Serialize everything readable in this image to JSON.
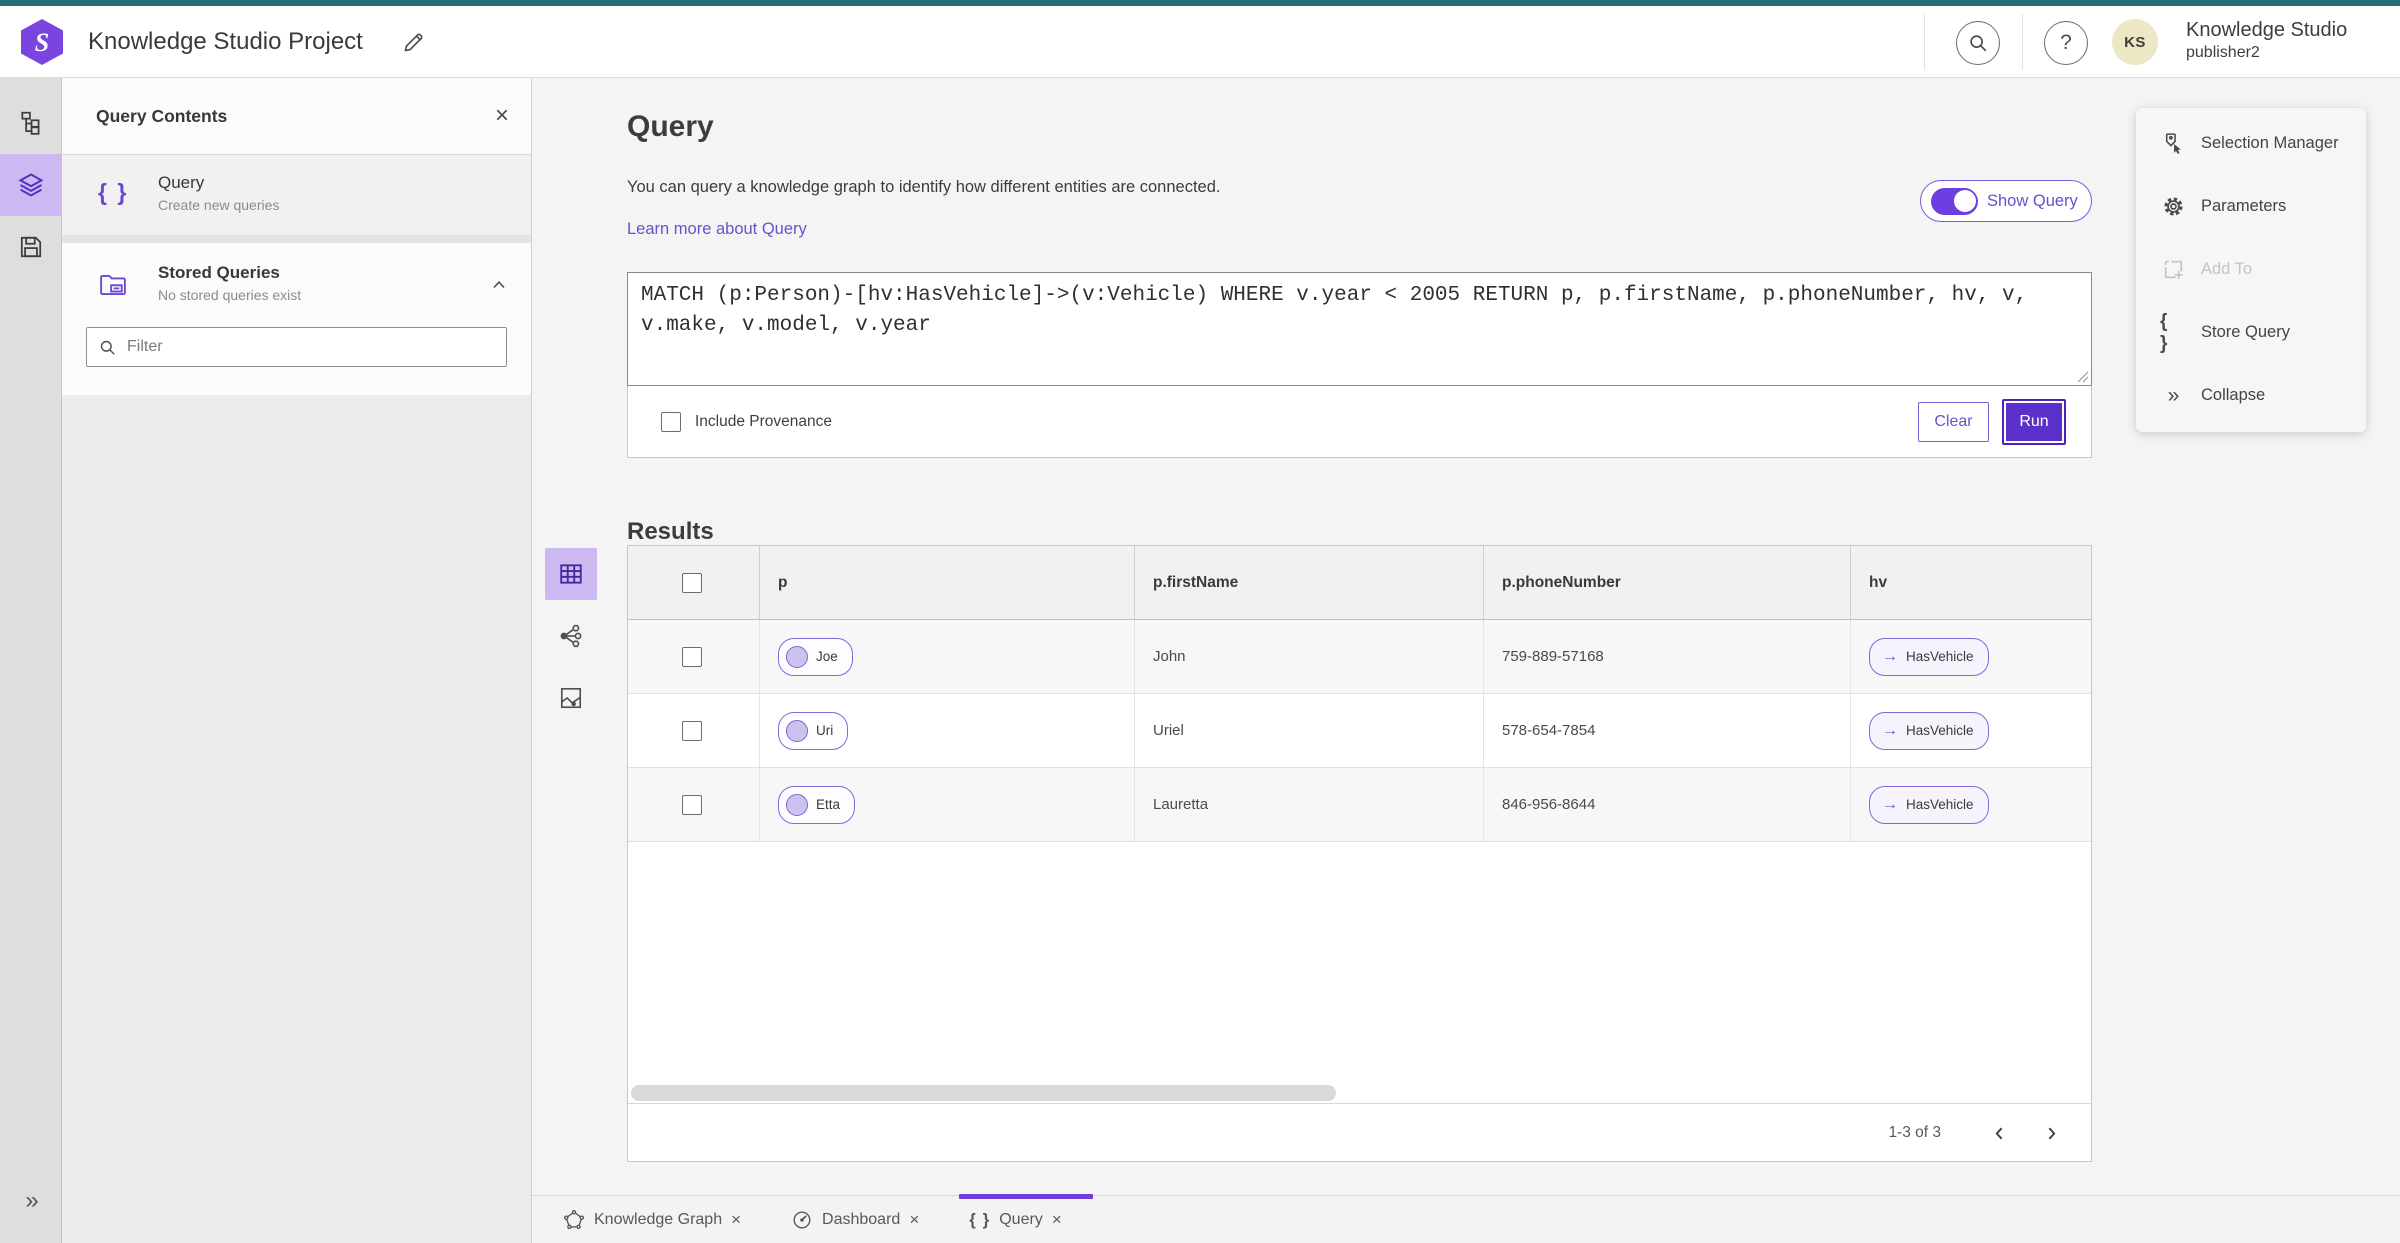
{
  "colors": {
    "accent": "#5b2fc9",
    "accent_light": "#7a5cd8",
    "selection_bg": "#ccb9f2",
    "link": "#6a50cf",
    "top_strip_teal": "#266e73",
    "avatar_bg": "#ece7c4"
  },
  "topbar": {
    "project_title": "Knowledge Studio Project",
    "product_name": "Knowledge Studio",
    "username": "publisher2",
    "avatar_initials": "KS",
    "help_glyph": "?"
  },
  "rail": {
    "expand_glyph": "»"
  },
  "panel": {
    "title": "Query Contents",
    "close_glyph": "×",
    "query_item": {
      "title": "Query",
      "subtitle": "Create new queries",
      "icon_glyph": "{ }"
    },
    "stored_queries": {
      "title": "Stored Queries",
      "subtitle": "No stored queries exist"
    },
    "filter_placeholder": "Filter"
  },
  "query_section": {
    "heading": "Query",
    "description": "You can query a knowledge graph to identify how different entities are connected.",
    "learn_more": "Learn more about Query",
    "show_query_label": "Show Query",
    "query_text": "MATCH (p:Person)-[hv:HasVehicle]->(v:Vehicle) WHERE v.year < 2005 RETURN p, p.firstName, p.phoneNumber, hv, v, v.make, v.model, v.year",
    "include_provenance_label": "Include Provenance",
    "clear_label": "Clear",
    "run_label": "Run"
  },
  "results": {
    "heading": "Results",
    "columns": [
      "p",
      "p.firstName",
      "p.phoneNumber",
      "hv"
    ],
    "rows": [
      {
        "p": "Joe",
        "firstName": "John",
        "phoneNumber": "759-889-57168",
        "hv": "HasVehicle"
      },
      {
        "p": "Uri",
        "firstName": "Uriel",
        "phoneNumber": "578-654-7854",
        "hv": "HasVehicle"
      },
      {
        "p": "Etta",
        "firstName": "Lauretta",
        "phoneNumber": "846-956-8644",
        "hv": "HasVehicle"
      }
    ],
    "edge_arrow_glyph": "→",
    "pagination": "1-3 of 3"
  },
  "right_menu": {
    "items": [
      {
        "label": "Selection Manager"
      },
      {
        "label": "Parameters"
      },
      {
        "label": "Add To"
      },
      {
        "label": "Store Query",
        "icon_glyph": "{ }"
      },
      {
        "label": "Collapse",
        "icon_glyph": "»"
      }
    ]
  },
  "tabbar": {
    "tabs": [
      {
        "label": "Knowledge Graph"
      },
      {
        "label": "Dashboard"
      },
      {
        "label": "Query",
        "icon_glyph": "{ }"
      }
    ],
    "close_glyph": "×"
  }
}
